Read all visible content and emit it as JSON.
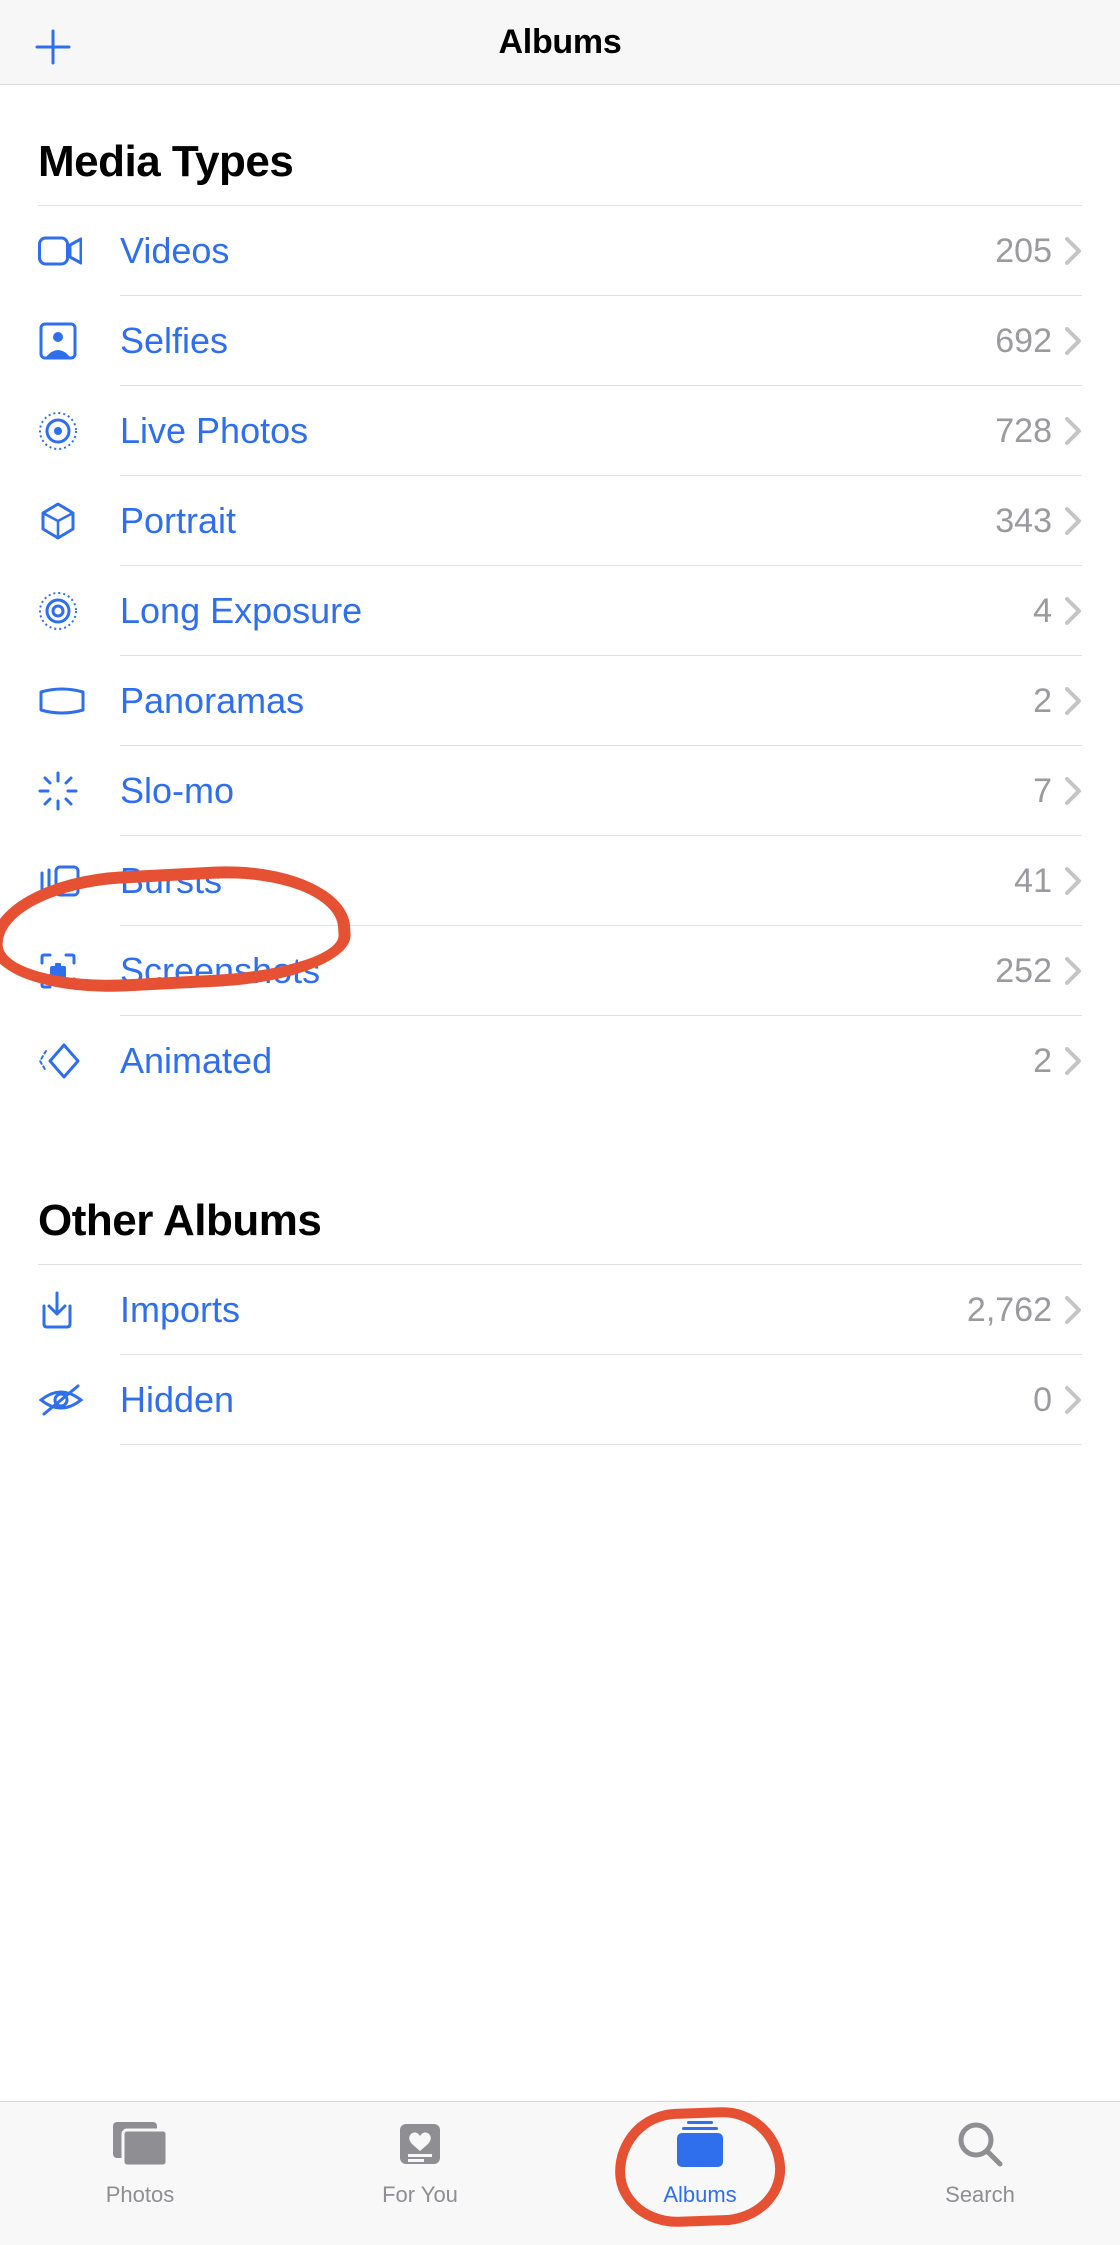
{
  "header": {
    "title": "Albums"
  },
  "sections": [
    {
      "title": "Media Types",
      "items": [
        {
          "label": "Videos",
          "count": "205",
          "icon": "video-icon"
        },
        {
          "label": "Selfies",
          "count": "692",
          "icon": "selfie-icon"
        },
        {
          "label": "Live Photos",
          "count": "728",
          "icon": "livephoto-icon"
        },
        {
          "label": "Portrait",
          "count": "343",
          "icon": "portrait-icon"
        },
        {
          "label": "Long Exposure",
          "count": "4",
          "icon": "longexposure-icon"
        },
        {
          "label": "Panoramas",
          "count": "2",
          "icon": "panorama-icon"
        },
        {
          "label": "Slo-mo",
          "count": "7",
          "icon": "slomo-icon"
        },
        {
          "label": "Bursts",
          "count": "41",
          "icon": "burst-icon",
          "highlighted": true
        },
        {
          "label": "Screenshots",
          "count": "252",
          "icon": "screenshot-icon"
        },
        {
          "label": "Animated",
          "count": "2",
          "icon": "animated-icon"
        }
      ]
    },
    {
      "title": "Other Albums",
      "items": [
        {
          "label": "Imports",
          "count": "2,762",
          "icon": "imports-icon"
        },
        {
          "label": "Hidden",
          "count": "0",
          "icon": "hidden-icon"
        }
      ]
    }
  ],
  "tabbar": {
    "items": [
      {
        "label": "Photos",
        "icon": "photos-tab-icon",
        "active": false
      },
      {
        "label": "For You",
        "icon": "foryou-tab-icon",
        "active": false
      },
      {
        "label": "Albums",
        "icon": "albums-tab-icon",
        "active": true,
        "highlighted": true
      },
      {
        "label": "Search",
        "icon": "search-tab-icon",
        "active": false
      }
    ]
  }
}
